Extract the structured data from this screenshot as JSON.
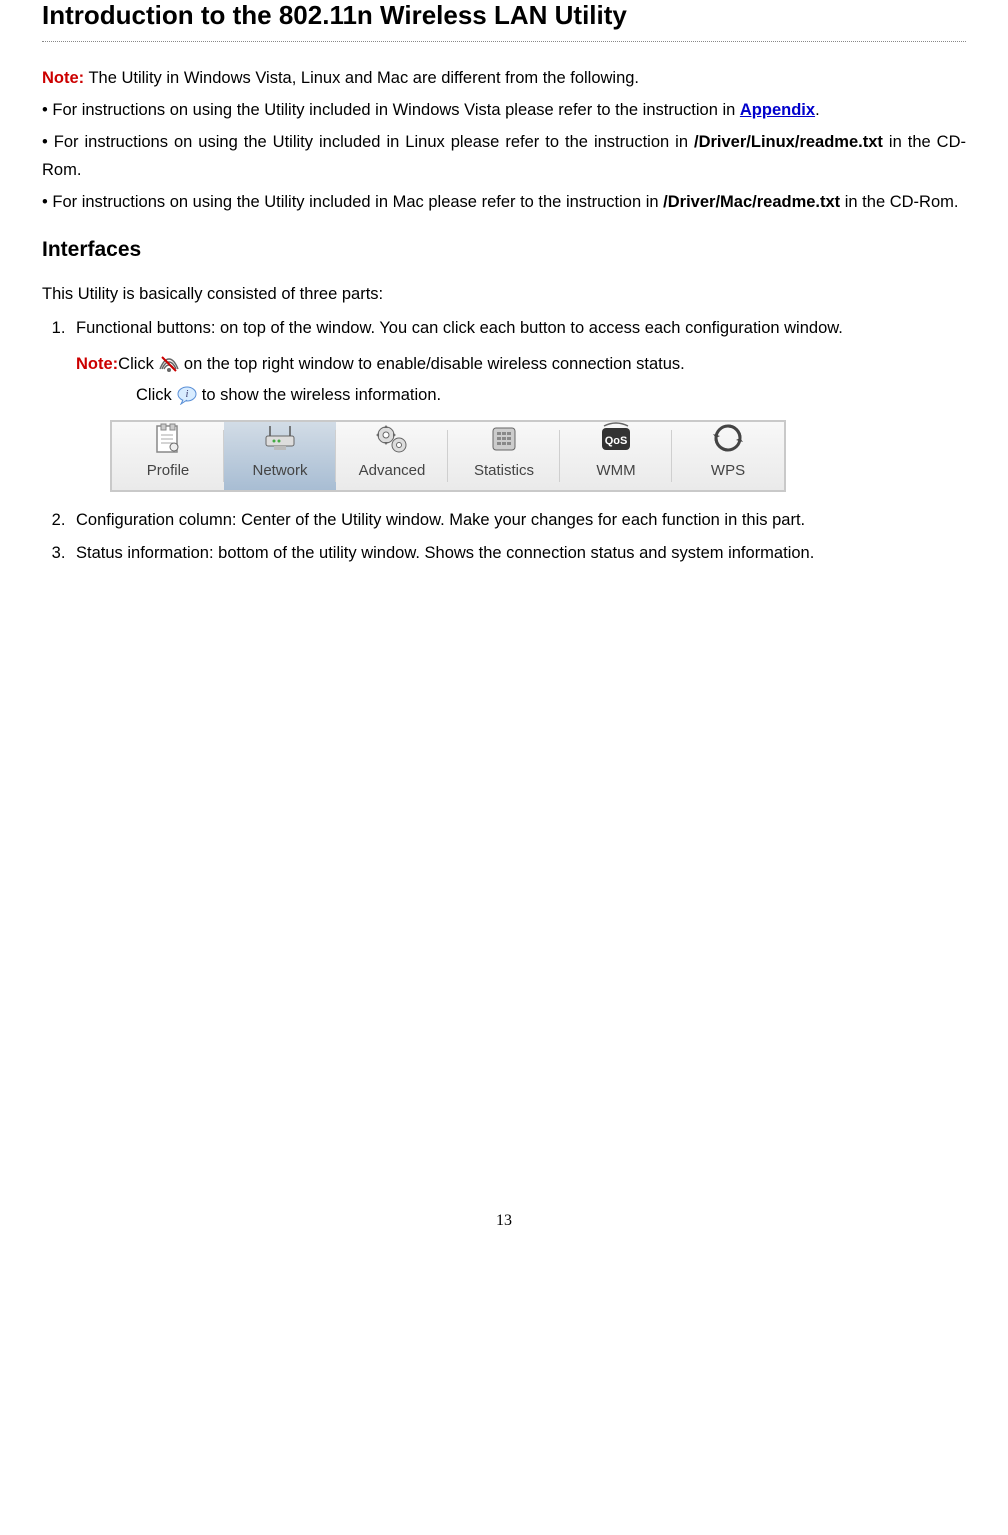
{
  "title": "Introduction to the 802.11n Wireless LAN Utility",
  "note_label": "Note:",
  "note_intro": " The Utility in Windows Vista, Linux and Mac are different from the following.",
  "bullets": {
    "vista_prefix": "• For instructions on using the Utility included in Windows Vista please refer to the instruction in ",
    "vista_link": "Appendix",
    "vista_suffix": ".",
    "linux_prefix": "• For instructions on using the Utility included in Linux please refer to the instruction in ",
    "linux_path": "/Driver/Linux/readme.txt",
    "linux_suffix": " in the CD-Rom.",
    "mac_prefix": "• For instructions on using the Utility included in Mac please refer to the instruction in ",
    "mac_path": "/Driver/Mac/readme.txt",
    "mac_suffix": " in the CD-Rom."
  },
  "interfaces_title": "Interfaces",
  "interfaces_intro": "This Utility is basically consisted of three parts:",
  "list": {
    "item1": "Functional buttons: on top of the window. You can click each button to access each configuration window.",
    "item1_note_prefix": " Click ",
    "item1_note_line1_suffix": " on the top right window to enable/disable wireless connection status.",
    "item1_note_line2_prefix": "Click ",
    "item1_note_line2_suffix": " to show the wireless information.",
    "item2": "Configuration column: Center of the Utility window. Make your changes for each function in this part.",
    "item3": "Status information: bottom of the utility window. Shows the connection status and system information."
  },
  "toolbar": {
    "profile": "Profile",
    "network": "Network",
    "advanced": "Advanced",
    "statistics": "Statistics",
    "wmm": "WMM",
    "wps": "WPS"
  },
  "page_number": "13"
}
